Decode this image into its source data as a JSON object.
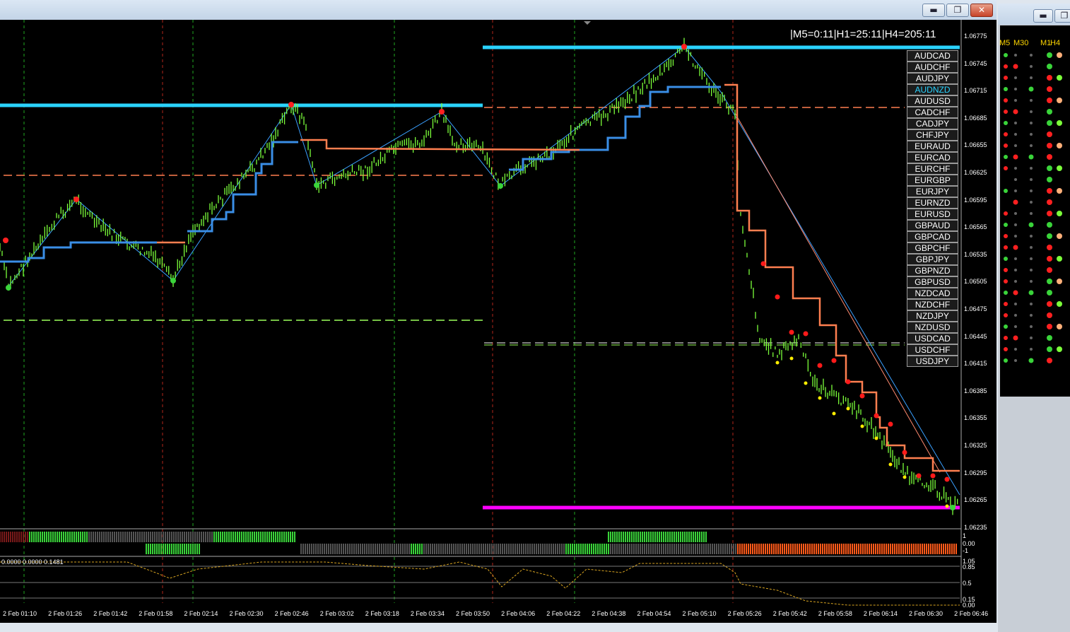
{
  "window": {
    "minimize_glyph": "▬",
    "restore_glyph": "❐",
    "close_glyph": "✕"
  },
  "timer": "|M5=0:11|H1=25:11|H4=205:11",
  "symbols": [
    "AUDCAD",
    "AUDCHF",
    "AUDJPY",
    "AUDNZD",
    "AUDUSD",
    "CADCHF",
    "CADJPY",
    "CHFJPY",
    "EURAUD",
    "EURCAD",
    "EURCHF",
    "EURGBP",
    "EURJPY",
    "EURNZD",
    "EURUSD",
    "GBPAUD",
    "GBPCAD",
    "GBPCHF",
    "GBPJPY",
    "GBPNZD",
    "GBPUSD",
    "NZDCAD",
    "NZDCHF",
    "NZDJPY",
    "NZDUSD",
    "USDCAD",
    "USDCHF",
    "USDJPY"
  ],
  "active_symbol": "AUDNZD",
  "price_labels": [
    "1.06775",
    "1.06745",
    "1.06715",
    "1.06685",
    "1.06655",
    "1.06625",
    "1.06595",
    "1.06565",
    "1.06535",
    "1.06505",
    "1.06475",
    "1.06445",
    "1.06415",
    "1.06385",
    "1.06355",
    "1.06325",
    "1.06295",
    "1.06265",
    "1.06235"
  ],
  "time_labels": [
    "2 Feb 01:10",
    "2 Feb 01:26",
    "2 Feb 01:42",
    "2 Feb 01:58",
    "2 Feb 02:14",
    "2 Feb 02:30",
    "2 Feb 02:46",
    "2 Feb 03:02",
    "2 Feb 03:18",
    "2 Feb 03:34",
    "2 Feb 03:50",
    "2 Feb 04:06",
    "2 Feb 04:22",
    "2 Feb 04:38",
    "2 Feb 04:54",
    "2 Feb 05:10",
    "2 Feb 05:26",
    "2 Feb 05:42",
    "2 Feb 05:58",
    "2 Feb 06:14",
    "2 Feb 06:30",
    "2 Feb 06:46"
  ],
  "histogram_scale": [
    "1",
    "0.00",
    "-1"
  ],
  "indicator2": {
    "label": "0.0000 0.0000 0.1481",
    "scale": [
      "1.05",
      "0.85",
      "0.5",
      "0.15",
      "0.00"
    ]
  },
  "side": {
    "headers": [
      "M5",
      "M30",
      "M1",
      "H4"
    ]
  },
  "colors": {
    "cyan": "#2ad3ff",
    "magenta": "#ff00ff",
    "orange": "#ff7f50",
    "blue": "#3a8ee6",
    "green": "#7cff3a"
  }
}
